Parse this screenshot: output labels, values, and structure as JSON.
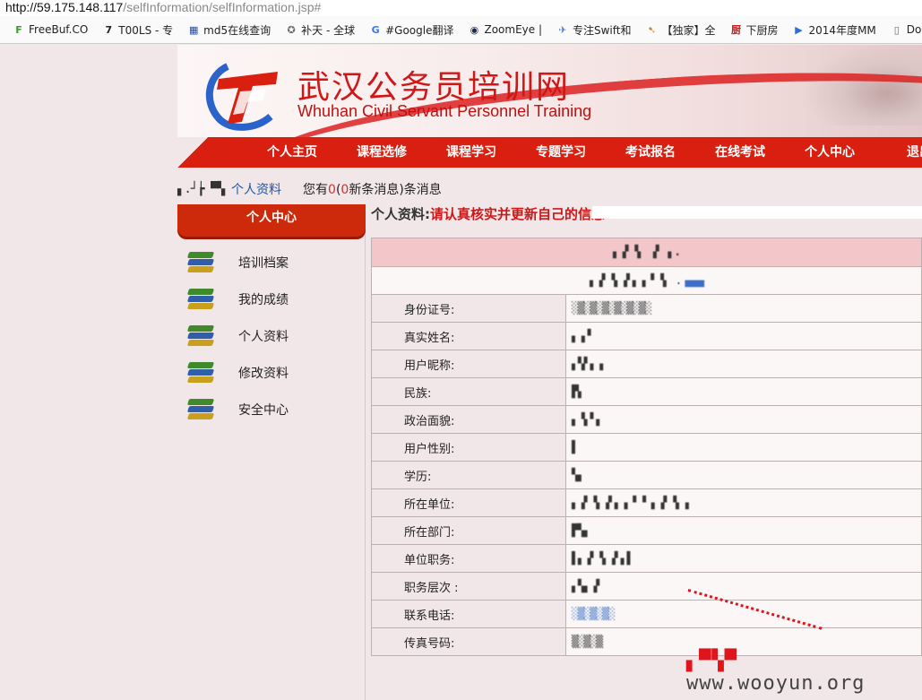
{
  "browser": {
    "url_host": "http://59.175.148.117",
    "url_path": "/selfInformation/selfInformation.jsp#"
  },
  "bookmarks": [
    {
      "label": "FreeBuf.CO",
      "icon": "freebuf-icon",
      "color": "#3a9a2c",
      "glyph": "F"
    },
    {
      "label": "T00LS - 专",
      "icon": "tools-icon",
      "color": "#222222",
      "glyph": "7"
    },
    {
      "label": "md5在线查询",
      "icon": "grid-icon",
      "color": "#2a4a9a",
      "glyph": "▦"
    },
    {
      "label": "补天 - 全球",
      "icon": "star-icon",
      "color": "#666666",
      "glyph": "✪"
    },
    {
      "label": "#Google翻译",
      "icon": "translate-icon",
      "color": "#3b78e7",
      "glyph": "G"
    },
    {
      "label": "ZoomEye |",
      "icon": "zoomeye-icon",
      "color": "#1a2a4a",
      "glyph": "◉"
    },
    {
      "label": "专注Swift和",
      "icon": "swift-icon",
      "color": "#4a7ac9",
      "glyph": "✈"
    },
    {
      "label": "【独家】全",
      "icon": "bird-icon",
      "color": "#e07a1a",
      "glyph": "➷"
    },
    {
      "label": "下厨房",
      "icon": "kitchen-icon",
      "color": "#d01717",
      "glyph": "厨"
    },
    {
      "label": "2014年度MM",
      "icon": "play-icon",
      "color": "#2a6fd1",
      "glyph": "▶"
    },
    {
      "label": "Dor",
      "icon": "document-icon",
      "color": "#666666",
      "glyph": "▯"
    }
  ],
  "banner": {
    "title_cn": "武汉公务员培训网",
    "title_en": "Whuhan Civil Servant Personnel Training"
  },
  "nav": [
    "个人主页",
    "课程选修",
    "课程学习",
    "专题学习",
    "考试报名",
    "在线考试",
    "个人中心",
    "退出"
  ],
  "crumb": {
    "masked": "▖.┘┢ ▀▚",
    "link": "个人资料",
    "msg_pre": "您有",
    "msg_count": "0",
    "msg_mid": "(",
    "msg_new": "0",
    "msg_post": "新条消息)条消息"
  },
  "sidebar": {
    "header": "个人中心",
    "items": [
      "培训档案",
      "我的成绩",
      "个人资料",
      "修改资料",
      "安全中心"
    ]
  },
  "main": {
    "title_prefix": "个人资料:",
    "title_note": "请认真核实并更新自己的信息",
    "table_header": "▖▗▘▝▖ ▗▘ ▖.",
    "subheader": "▖▗▘▝▖▗▘▖▗ ▘▝▖ .",
    "subheader_link": "▄▄▄",
    "rows": [
      {
        "label": "身份证号:",
        "value": "░▒░▒░▒░▒░▒░▒░",
        "blue": false
      },
      {
        "label": "真实姓名:",
        "value": "▖▗▝",
        "blue": false
      },
      {
        "label": "用户昵称:",
        "value": "▖▚▘▖▗",
        "blue": false
      },
      {
        "label": "民族:",
        "value": "▛▖",
        "blue": false
      },
      {
        "label": "政治面貌:",
        "value": "▖▝▖▘▖",
        "blue": false
      },
      {
        "label": "用户性别:",
        "value": "▌",
        "blue": false
      },
      {
        "label": "学历:",
        "value": "▚▖",
        "blue": false
      },
      {
        "label": "所在单位:",
        "value": "▖▗▘▝▖▗▘▖▗ ▘▝ ▖▗▘▝▖▗",
        "blue": false
      },
      {
        "label": "所在部门:",
        "value": "▛▚▖",
        "blue": false
      },
      {
        "label": "单位职务:",
        "value": "▌▖▗▘▝▖▗▘▖▌",
        "blue": false
      },
      {
        "label": "职务层次 :",
        "value": "▖▚▖▗▘",
        "blue": false
      },
      {
        "label": "联系电话:",
        "value": "░▒░▒░▒░",
        "blue": true
      },
      {
        "label": "传真号码:",
        "value": "▒░▒░▒",
        "blue": false
      }
    ]
  },
  "watermark": {
    "mark": "▖▀▚▀",
    "site": "www.wooyun.org"
  }
}
